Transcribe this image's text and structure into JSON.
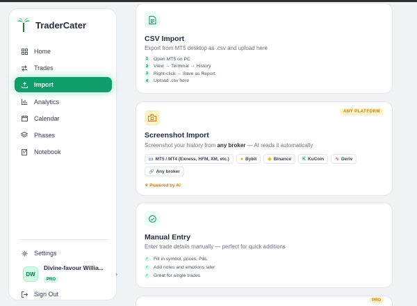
{
  "brand": {
    "name": "TraderCater"
  },
  "nav": [
    {
      "label": "Home",
      "icon": "grid-icon"
    },
    {
      "label": "Trades",
      "icon": "swap-icon"
    },
    {
      "label": "Import",
      "icon": "upload-icon",
      "active": true
    },
    {
      "label": "Analytics",
      "icon": "bar-chart-icon"
    },
    {
      "label": "Calendar",
      "icon": "calendar-icon"
    },
    {
      "label": "Phases",
      "icon": "layers-icon"
    },
    {
      "label": "Notebook",
      "icon": "notebook-icon"
    }
  ],
  "settings": {
    "label": "Settings"
  },
  "user": {
    "initials": "DW",
    "name": "Divine-favour Willia...",
    "plan": "PRO"
  },
  "signout": {
    "label": "Sign Out"
  },
  "csv": {
    "title": "CSV Import",
    "subtitle": "Export from MT5 desktop as .csv and upload here",
    "steps": [
      {
        "n": "1",
        "text": "Open MT5 on PC"
      },
      {
        "n": "2",
        "text": "View → Terminal → History"
      },
      {
        "n": "3",
        "text": "Right-click → Save as Report"
      },
      {
        "n": "4",
        "text": "Upload .csv here"
      }
    ]
  },
  "screenshot": {
    "badge": "ANY PLATFORM",
    "title": "Screenshot Import",
    "subtitle_pre": "Screenshot your history from ",
    "subtitle_bold": "any broker",
    "subtitle_post": " — AI reads it automatically",
    "chips": [
      {
        "label": "MT5 / MT4 (Exness, HFM, XM, etc.)",
        "icon": "monitor-icon",
        "color": "#2563eb",
        "glyph": "▭"
      },
      {
        "label": "Bybit",
        "icon": "bybit-icon",
        "color": "#f59e0b",
        "glyph": "●"
      },
      {
        "label": "Binance",
        "icon": "binance-icon",
        "color": "#f0b90b",
        "glyph": "◆"
      },
      {
        "label": "KuCoin",
        "icon": "kucoin-icon",
        "color": "#10b981",
        "glyph": "K"
      },
      {
        "label": "Deriv",
        "icon": "deriv-icon",
        "color": "#ef4444",
        "glyph": "∿"
      },
      {
        "label": "Any broker",
        "icon": "link-icon",
        "color": "#6b7280",
        "glyph": "🔗"
      }
    ],
    "powered": "✧ Powered by AI"
  },
  "manual": {
    "title": "Manual Entry",
    "subtitle": "Enter trade details manually — perfect for quick additions",
    "items": [
      "Fill in symbol, prices, P&L",
      "Add notes and emotions later",
      "Great for single trades"
    ]
  },
  "next_card": {
    "badge": "PRO"
  },
  "colors": {
    "accent": "#0f9d6a",
    "amber": "#d97706"
  }
}
